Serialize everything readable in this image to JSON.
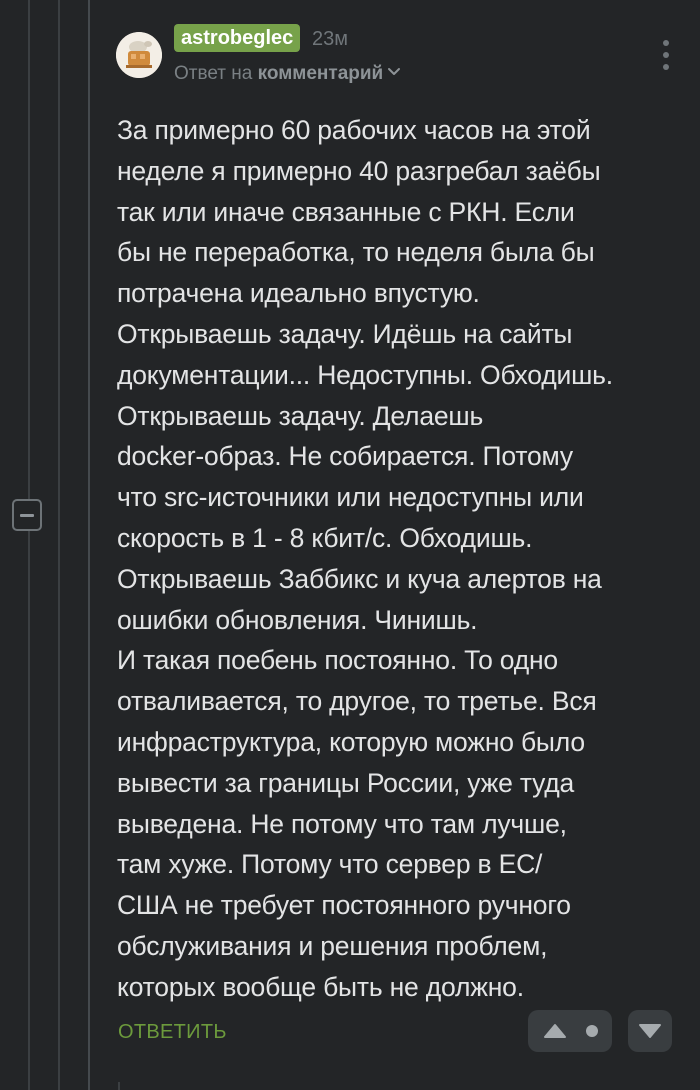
{
  "comment": {
    "username": "astrobeglec",
    "time": "23м",
    "reply_to_prefix": "Ответ на ",
    "reply_to_link": "комментарий",
    "body_lines": [
      "За примерно 60 рабочих часов на этой",
      "неделе я примерно 40 разгребал заёбы",
      "так или иначе связанные с РКН. Если",
      "бы не переработка, то неделя была бы",
      "потрачена идеально впустую.",
      "Открываешь задачу. Идёшь на сайты",
      "документации... Недоступны. Обходишь.",
      "Открываешь задачу. Делаешь",
      "docker-образ. Не собирается. Потому",
      "что src-источники или недоступны или",
      "скорость в 1 - 8 кбит/с. Обходишь.",
      "Открываешь Заббикс и куча алертов на",
      "ошибки обновления. Чинишь.",
      "И такая поебень постоянно. То одно",
      "отваливается, то другое, то третье. Вся",
      "инфраструктура, которую можно было",
      "вывести за границы России, уже туда",
      "выведена. Не потому что там лучше,",
      "там хуже. Потому что сервер в ЕС/",
      "США не требует постоянного ручного",
      "обслуживания и решения проблем,",
      "которых вообще быть не должно."
    ],
    "reply_label": "ОТВЕТИТЬ"
  },
  "icons": {
    "avatar": "avatar",
    "menu": "more-vertical-icon",
    "chevron": "chevron-down-icon",
    "collapse": "collapse-minus-icon",
    "vote_up": "triangle-up-icon",
    "vote_down": "triangle-down-icon"
  },
  "colors": {
    "background": "#232527",
    "username_badge": "#77a24a",
    "reply_link": "#6c9a3c",
    "text": "#e3e4e5",
    "muted": "#70767a",
    "vote_button_bg": "#393d40"
  }
}
